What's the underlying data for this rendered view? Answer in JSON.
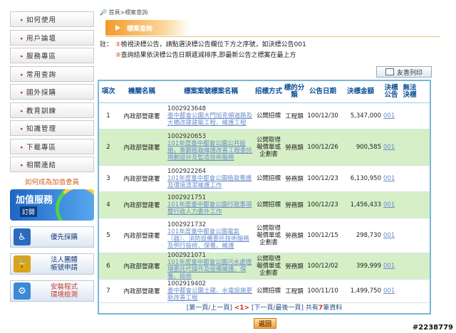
{
  "sidebar": {
    "items": [
      {
        "label": "如何使用"
      },
      {
        "label": "用戶論壇"
      },
      {
        "label": "服務專區"
      },
      {
        "label": "常用查詢"
      },
      {
        "label": "國外採購"
      },
      {
        "label": "教育訓練"
      },
      {
        "label": "知識管理"
      },
      {
        "label": "下載專區"
      },
      {
        "label": "相關連結"
      }
    ],
    "member_link": "如何成為加值會員",
    "vip_title": "加值服務",
    "vip_sub": "訂閱",
    "btn_priority": "優先採購",
    "btn_corp": "法人團體\n帳號申請",
    "btn_env": "安裝程式\n環境檢測"
  },
  "breadcrumb": "首頁>標案查詢",
  "section_title": "標案查詢",
  "notes": {
    "label": "註：",
    "line1": "檢視決標公告，請點選決標公告欄位下方之序號，如決標公告001",
    "line2": "查詢結果依決標公告日期遞減排序,即最新公告之標案在最上方"
  },
  "print_button": "友善列印",
  "table": {
    "headers": {
      "no": "項次",
      "org": "機關名稱",
      "case": "標案案號標案名稱",
      "method": "招標方式",
      "category": "標的分類",
      "date": "公告日期",
      "amount": "決標金額",
      "award": "決標公告",
      "fail": "無法決標"
    },
    "rows": [
      {
        "no": "1",
        "org": "內政部營建署",
        "case_id": "1002923648",
        "case_name": "臺中都會公園大門旭克頓道路及大橋改建建築工程，維護工程",
        "method": "公開招標",
        "category": "工程類",
        "date": "100/12/30",
        "amount": "5,347,000",
        "award": "001"
      },
      {
        "no": "2",
        "org": "內政部營建署",
        "case_id": "1002920653",
        "case_name": "101年度臺中都會公園公共設施，景觀植栽維護改善工程委託規劃設計及監造技術服務",
        "method": "公開取得報價單或企劃書",
        "category": "勞務類",
        "date": "100/12/26",
        "amount": "900,585",
        "award": "001"
      },
      {
        "no": "3",
        "org": "內政部營建署",
        "case_id": "1002922264",
        "case_name": "101年度臺中都會公園植栽養護及環境清潔維護工作",
        "method": "公開招標",
        "category": "勞務類",
        "date": "100/12/23",
        "amount": "6,130,950",
        "award": "001"
      },
      {
        "no": "4",
        "org": "內政部營建署",
        "case_id": "1002921751",
        "case_name": "101年度臺中都會公園行政事項暨行政人力委外工作",
        "method": "公開招標",
        "category": "勞務類",
        "date": "100/12/23",
        "amount": "1,456,433",
        "award": "001"
      },
      {
        "no": "5",
        "org": "內政部營建署",
        "case_id": "1002921732",
        "case_name": "101年度臺中都會公園電氣（器）、消防設備委託技術服務及例行檢修、保養、維護",
        "method": "公開取得報價單或企劃書",
        "category": "勞務類",
        "date": "100/12/15",
        "amount": "298,730",
        "award": "001"
      },
      {
        "no": "6",
        "org": "內政部營建署",
        "case_id": "1002921071",
        "case_name": "101年度臺中都會公園污水處理場委託代操作及設備維護、保養、檢修",
        "method": "公開取得報價單或企劃書",
        "category": "勞務類",
        "date": "100/12/02",
        "amount": "399,999",
        "award": "001"
      },
      {
        "no": "7",
        "org": "內政部營建署",
        "case_id": "1002919402",
        "case_name": "臺中都會公園土建、水電設施更新改善工程",
        "method": "公開招標",
        "category": "工程類",
        "date": "100/11/10",
        "amount": "1,499,750",
        "award": "001"
      }
    ],
    "pager": {
      "prev": "[第一頁/上一頁]",
      "page": "<1>",
      "next": "[下一頁/最後一頁]",
      "total_pre": "共有",
      "total": "7",
      "total_post": "筆資料"
    }
  },
  "back_button": "返回",
  "watermark": "#2238779"
}
